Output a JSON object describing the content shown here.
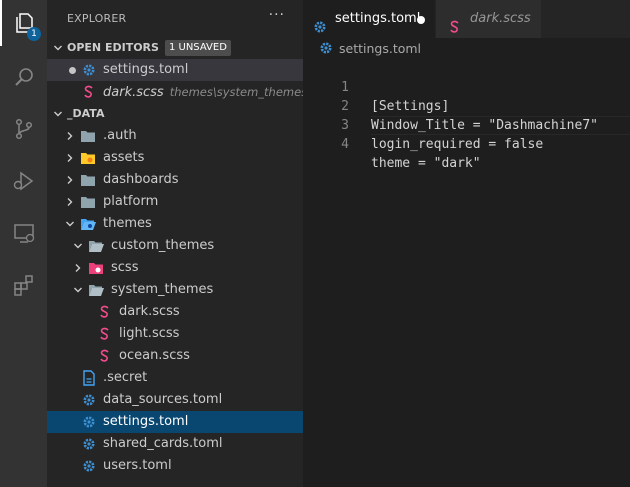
{
  "explorer": {
    "title": "EXPLORER",
    "more": "···",
    "open_editors": {
      "label": "OPEN EDITORS",
      "unsaved_badge": "1 UNSAVED",
      "items": [
        {
          "name": "settings.toml",
          "description": ""
        },
        {
          "name": "dark.scss",
          "description": "themes\\system_themes"
        }
      ]
    },
    "folder": {
      "label": "_DATA",
      "items": [
        {
          "name": ".auth"
        },
        {
          "name": "assets"
        },
        {
          "name": "dashboards"
        },
        {
          "name": "platform"
        },
        {
          "name": "themes"
        },
        {
          "name": "custom_themes"
        },
        {
          "name": "scss"
        },
        {
          "name": "system_themes"
        },
        {
          "name": "dark.scss"
        },
        {
          "name": "light.scss"
        },
        {
          "name": "ocean.scss"
        },
        {
          "name": ".secret"
        },
        {
          "name": "data_sources.toml"
        },
        {
          "name": "settings.toml"
        },
        {
          "name": "shared_cards.toml"
        },
        {
          "name": "users.toml"
        }
      ]
    }
  },
  "activity_bar": {
    "explorer_badge": "1",
    "icons": [
      "files-icon",
      "search-icon",
      "source-control-icon",
      "run-debug-icon",
      "remote-explorer-icon",
      "extensions-icon"
    ]
  },
  "editor": {
    "tabs": [
      {
        "label": "settings.toml",
        "active": true,
        "dirty": true
      },
      {
        "label": "dark.scss",
        "active": false,
        "dirty": false
      }
    ],
    "breadcrumb": "settings.toml",
    "lines": [
      {
        "num": "1",
        "text": "[Settings]"
      },
      {
        "num": "2",
        "text": "Window_Title = \"Dashmachine7\""
      },
      {
        "num": "3",
        "text": "login_required = false"
      },
      {
        "num": "4",
        "text": "theme = \"dark\""
      }
    ]
  },
  "colors": {
    "gear": "#3d8fd1",
    "scss": "#f14c8c",
    "folder": "#90a4ae",
    "folder_assets": "#ffca28",
    "folder_themes": "#42a5f5",
    "selection": "#094771"
  }
}
